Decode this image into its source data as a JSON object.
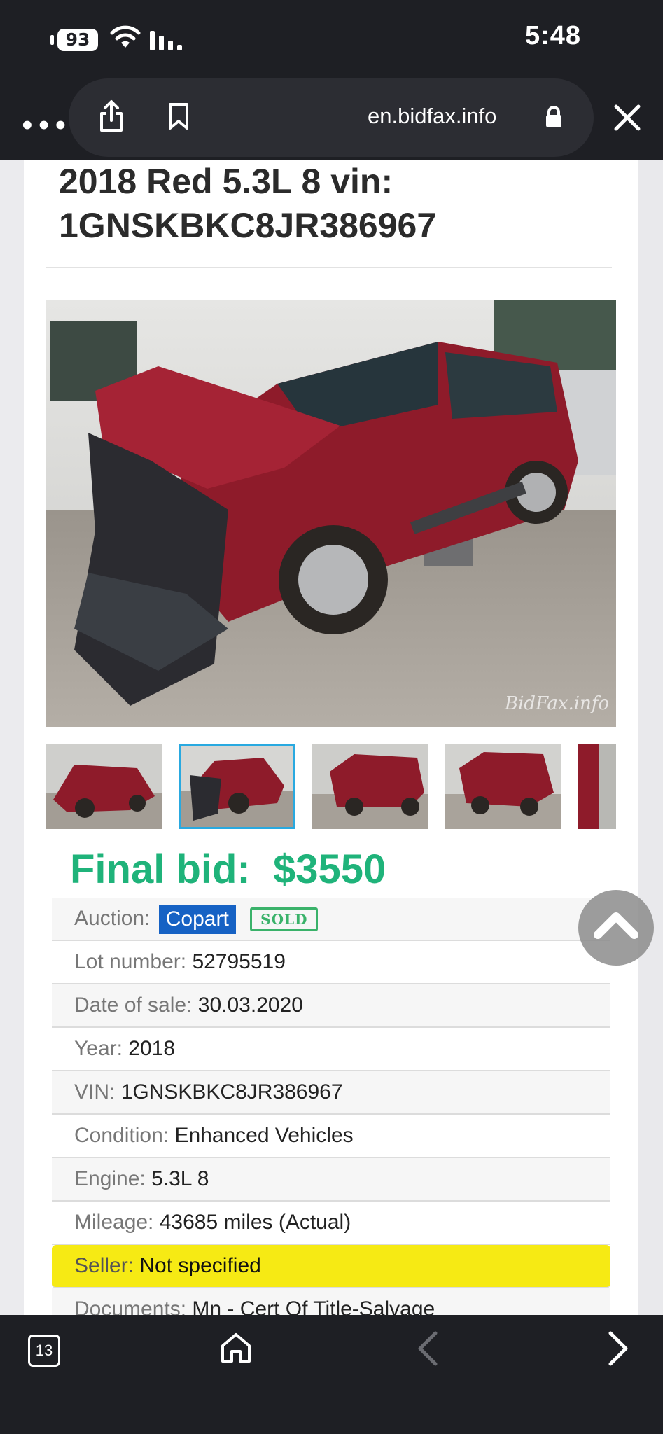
{
  "status_bar": {
    "battery": "93",
    "time": "5:48"
  },
  "browser": {
    "url": "en.bidfax.info",
    "tab_count": "13",
    "icons": [
      "more-icon",
      "share-icon",
      "bookmark-icon",
      "lock-icon",
      "close-icon",
      "tabs-icon",
      "home-icon",
      "back-icon",
      "forward-icon"
    ]
  },
  "listing": {
    "title": "2018 Red 5.3L 8 vin: 1GNSKBKC8JR386967",
    "photo_watermark": "BidFax.info",
    "final_bid_label": "Final bid:",
    "final_bid_value": "$3550",
    "auction_label": "Auction:",
    "auction_value": "Copart",
    "sold_badge": "SOLD",
    "specs": [
      {
        "label": "Lot number:",
        "value": "52795519"
      },
      {
        "label": "Date of sale:",
        "value": "30.03.2020"
      },
      {
        "label": "Year:",
        "value": "2018"
      },
      {
        "label": "VIN:",
        "value": "1GNSKBKC8JR386967"
      },
      {
        "label": "Condition:",
        "value": "Enhanced Vehicles"
      },
      {
        "label": "Engine:",
        "value": "5.3L 8"
      },
      {
        "label": "Mileage:",
        "value": "43685 miles (Actual)"
      },
      {
        "label": "Seller:",
        "value": "Not specified"
      },
      {
        "label": "Documents:",
        "value": "Mn - Cert Of Title-Salvage"
      }
    ]
  },
  "colors": {
    "chrome": "#1e1f24",
    "final_bid": "#1fb37a",
    "copart": "#1662c4",
    "seller_highlight": "#f6ea14",
    "thumb_active": "#29a9e0"
  }
}
